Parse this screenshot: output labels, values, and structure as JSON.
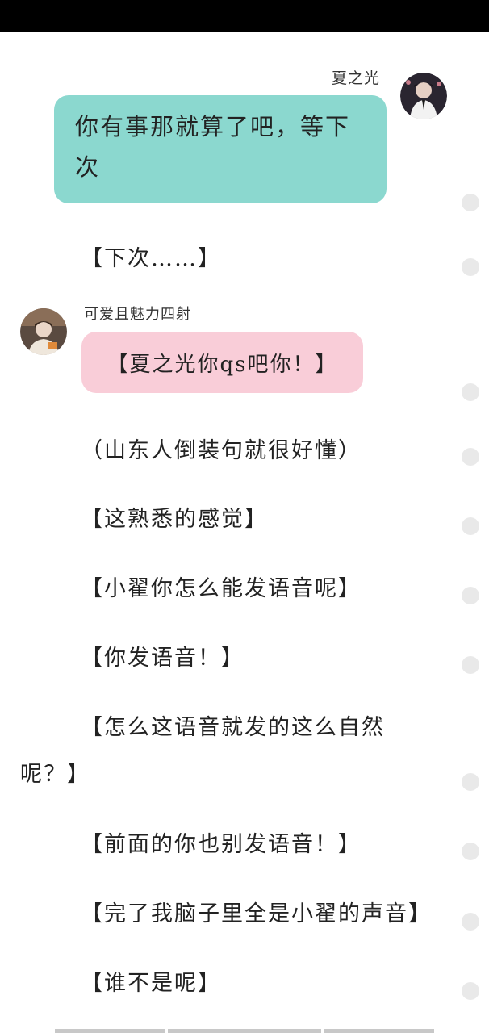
{
  "chat": {
    "sender_right_name": "夏之光",
    "message_right": "你有事那就算了吧，等下次",
    "narration_1": "【下次……】",
    "sender_left_name": "可爱且魅力四射",
    "message_left": "【夏之光你qs吧你！】",
    "narration_lines": [
      "（山东人倒装句就很好懂）",
      "【这熟悉的感觉】",
      "【小翟你怎么能发语音呢】",
      "【你发语音！】",
      "【怎么这语音就发的这么自然",
      "呢？】",
      "【前面的你也别发语音！】",
      "【完了我脑子里全是小翟的声音】",
      "【谁不是呢】"
    ]
  },
  "colors": {
    "status_bar": "#000000",
    "right_bubble": "#8bd8cf",
    "left_bubble": "#f9cdd8",
    "scroll_dots": "#e9e9e9"
  },
  "icons": {
    "right_avatar": "avatar-photo",
    "left_avatar": "avatar-photo"
  }
}
